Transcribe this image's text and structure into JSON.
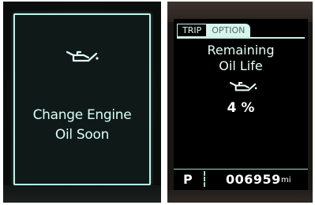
{
  "left_display": {
    "message_line1": "Change Engine",
    "message_line2": "Oil Soon",
    "icon": "oil-can-icon"
  },
  "right_display": {
    "tabs": [
      {
        "label": "TRIP",
        "active": false
      },
      {
        "label": "OPTION",
        "active": true
      }
    ],
    "title_line1": "Remaining",
    "title_line2": "Oil Life",
    "icon": "oil-can-icon",
    "oil_life_percent": "4 %",
    "gear": "P",
    "odometer": "006959",
    "odometer_unit": "mi"
  },
  "colors": {
    "display_text": "#d9fff7",
    "border_glow": "#b9f5ea",
    "screen_bg": "#0f1a18"
  }
}
